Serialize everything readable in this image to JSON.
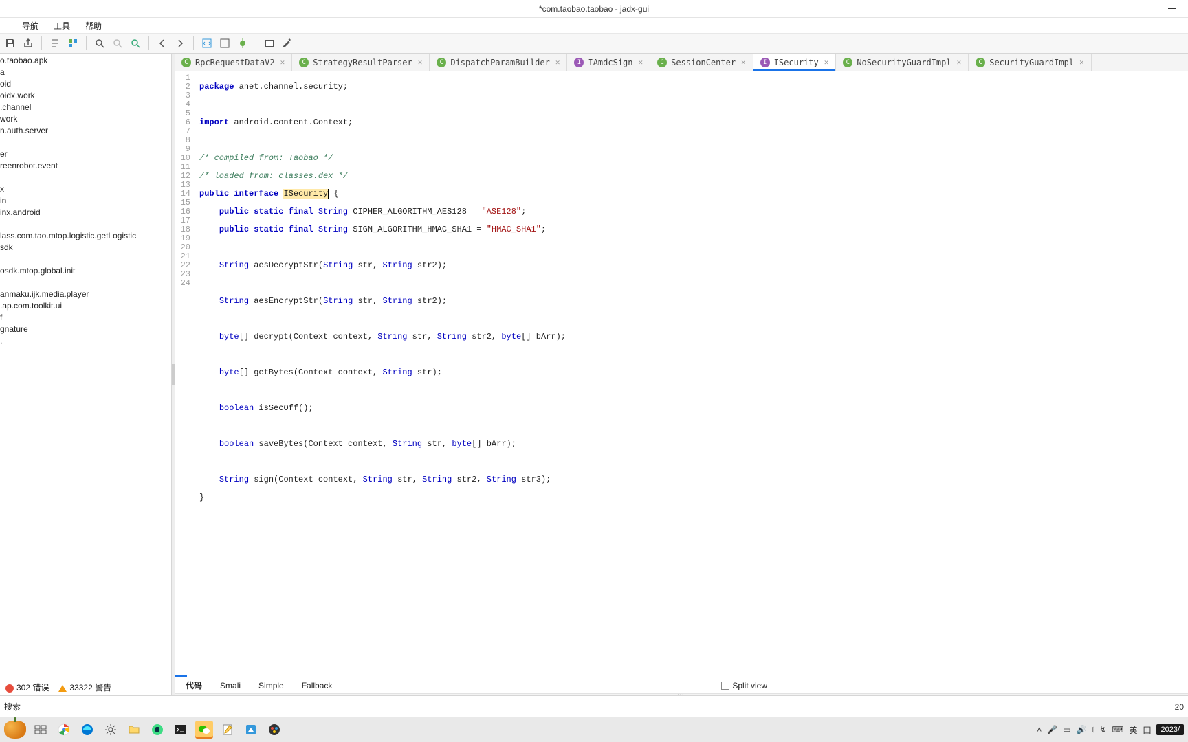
{
  "window": {
    "title": "*com.taobao.taobao - jadx-gui"
  },
  "menu": {
    "items": [
      "",
      "导航",
      "工具",
      "帮助"
    ]
  },
  "sidebar": {
    "root": "o.taobao.apk",
    "items": [
      "a",
      "oid",
      "oidx.work",
      ".channel",
      "work",
      "n.auth.server",
      "",
      "er",
      "reenrobot.event",
      "",
      "x",
      "in",
      "inx.android",
      "",
      "lass.com.tao.mtop.logistic.getLogistic",
      "sdk",
      "",
      "osdk.mtop.global.init",
      "",
      "anmaku.ijk.media.player",
      ".ap.com.toolkit.ui",
      "f",
      "gnature",
      "."
    ],
    "errors": {
      "count": "302",
      "label": "错误"
    },
    "warnings": {
      "count": "33322",
      "label": "警告"
    }
  },
  "tabs": [
    {
      "icon": "C",
      "name": "RpcRequestDataV2",
      "kind": "class"
    },
    {
      "icon": "C",
      "name": "StrategyResultParser",
      "kind": "class"
    },
    {
      "icon": "C",
      "name": "DispatchParamBuilder",
      "kind": "class"
    },
    {
      "icon": "I",
      "name": "IAmdcSign",
      "kind": "iface"
    },
    {
      "icon": "C",
      "name": "SessionCenter",
      "kind": "class"
    },
    {
      "icon": "I",
      "name": "ISecurity",
      "kind": "iface",
      "active": true
    },
    {
      "icon": "C",
      "name": "NoSecurityGuardImpl",
      "kind": "class"
    },
    {
      "icon": "C",
      "name": "SecurityGuardImpl",
      "kind": "class"
    }
  ],
  "code": {
    "package_kw": "package",
    "package_name": "anet.channel.security;",
    "import_kw": "import",
    "import_name": "android.content.Context;",
    "cm1": "/* compiled from: Taobao */",
    "cm2": "/* loaded from: classes.dex */",
    "decl_public": "public",
    "decl_interface": "interface",
    "decl_name": "ISecurity",
    "const1_mods": "public static final",
    "const1_type": "String",
    "const1_name": "CIPHER_ALGORITHM_AES128 = ",
    "const1_val": "\"ASE128\"",
    "const2_mods": "public static final",
    "const2_type": "String",
    "const2_name": "SIGN_ALGORITHM_HMAC_SHA1 = ",
    "const2_val": "\"HMAC_SHA1\"",
    "m_string": "String",
    "m_byte": "byte",
    "m_boolean": "boolean",
    "m1": "aesDecryptStr(",
    "m1_args_tail": " str, ",
    "m1_end": " str2);",
    "m2": "aesEncryptStr(",
    "m3_pre": "[] decrypt(Context context, ",
    "m3_mid": " str, ",
    "m3_mid2": " str2, ",
    "m3_end": "[] bArr);",
    "m4_pre": "[] getBytes(Context context, ",
    "m4_end": " str);",
    "m5": " isSecOff();",
    "m6_pre": " saveBytes(Context context, ",
    "m7_pre": " sign(Context context, ",
    "m7_mid3": " str3);"
  },
  "modebar": {
    "modes": [
      "代码",
      "Smali",
      "Simple",
      "Fallback"
    ],
    "split": "Split view"
  },
  "status": {
    "search_hint": "搜索",
    "cursor": "20"
  },
  "tray": {
    "ime1": "英",
    "ime2": "田",
    "date_partial": "2023/"
  }
}
